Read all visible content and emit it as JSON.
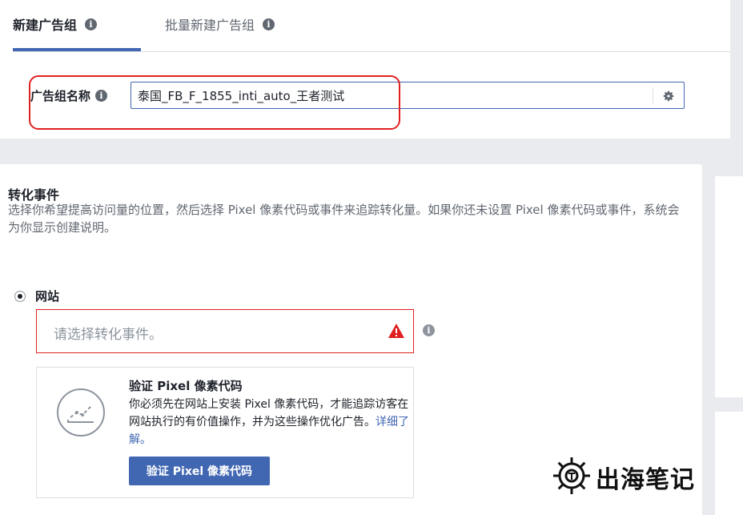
{
  "tabs": [
    {
      "label": "新建广告组",
      "active": true
    },
    {
      "label": "批量新建广告组",
      "active": false
    }
  ],
  "ad_group_name": {
    "label": "广告组名称",
    "value": "泰国_FB_F_1855_inti_auto_王者测试"
  },
  "conversion": {
    "title": "转化事件",
    "description": "选择你希望提高访问量的位置，然后选择 Pixel 像素代码或事件来追踪转化量。如果你还未设置 Pixel 像素代码或事件，系统会为你显示创建说明。",
    "option_label": "网站",
    "event_placeholder": "请选择转化事件。"
  },
  "verify_pixel": {
    "title": "验证 Pixel 像素代码",
    "body": "你必须先在网站上安装 Pixel 像素代码，才能追踪访客在网站执行的有价值操作，并为这些操作优化广告。",
    "link": "详细了解。",
    "button": "验证 Pixel 像素代码"
  },
  "watermark": {
    "text": "出海笔记"
  },
  "icons": {
    "info": "info-icon",
    "gear": "gear-icon",
    "warning": "warning-triangle-icon",
    "chart": "line-chart-icon",
    "logo": "ship-wheel-logo"
  },
  "colors": {
    "accent": "#4267b2",
    "error": "#e02020",
    "background": "#e9ebee",
    "text": "#1d2129",
    "muted": "#606770"
  }
}
